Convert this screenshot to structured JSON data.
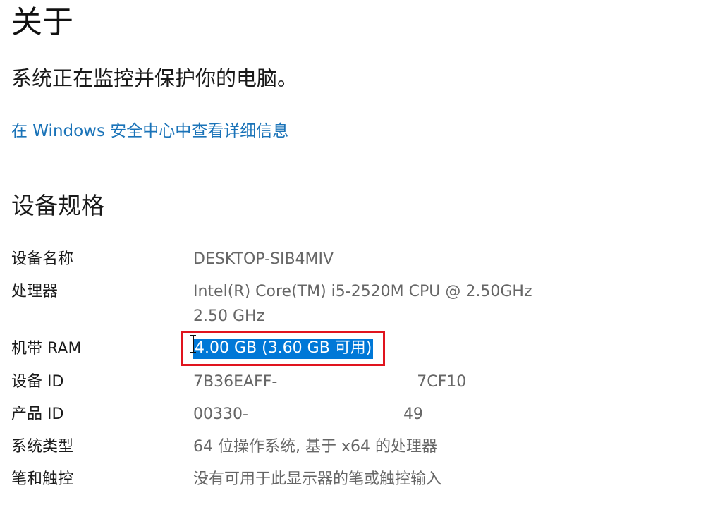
{
  "header": {
    "title": "关于",
    "status": "系统正在监控并保护你的电脑。",
    "link": "在 Windows 安全中心中查看详细信息"
  },
  "specs": {
    "section_title": "设备规格",
    "rows": [
      {
        "label": "设备名称",
        "value": "DESKTOP-SIB4MIV"
      },
      {
        "label": "处理器",
        "value": "Intel(R) Core(TM) i5-2520M CPU @ 2.50GHz",
        "value_line2": "2.50 GHz"
      },
      {
        "label": "机带 RAM",
        "value": "4.00 GB (3.60 GB 可用)"
      },
      {
        "label": "设备 ID",
        "value_start": "7B36EAFF-",
        "value_end": "7CF10"
      },
      {
        "label": "产品 ID",
        "value_start": "00330-",
        "value_end": "49"
      },
      {
        "label": "系统类型",
        "value": "64 位操作系统, 基于 x64 的处理器"
      },
      {
        "label": "笔和触控",
        "value": "没有可用于此显示器的笔或触控输入"
      }
    ]
  },
  "icons": {
    "cursor": "text-cursor-icon"
  },
  "colors": {
    "link": "#1a73b8",
    "selection": "#0078d7",
    "highlight_border": "#e0141e"
  }
}
